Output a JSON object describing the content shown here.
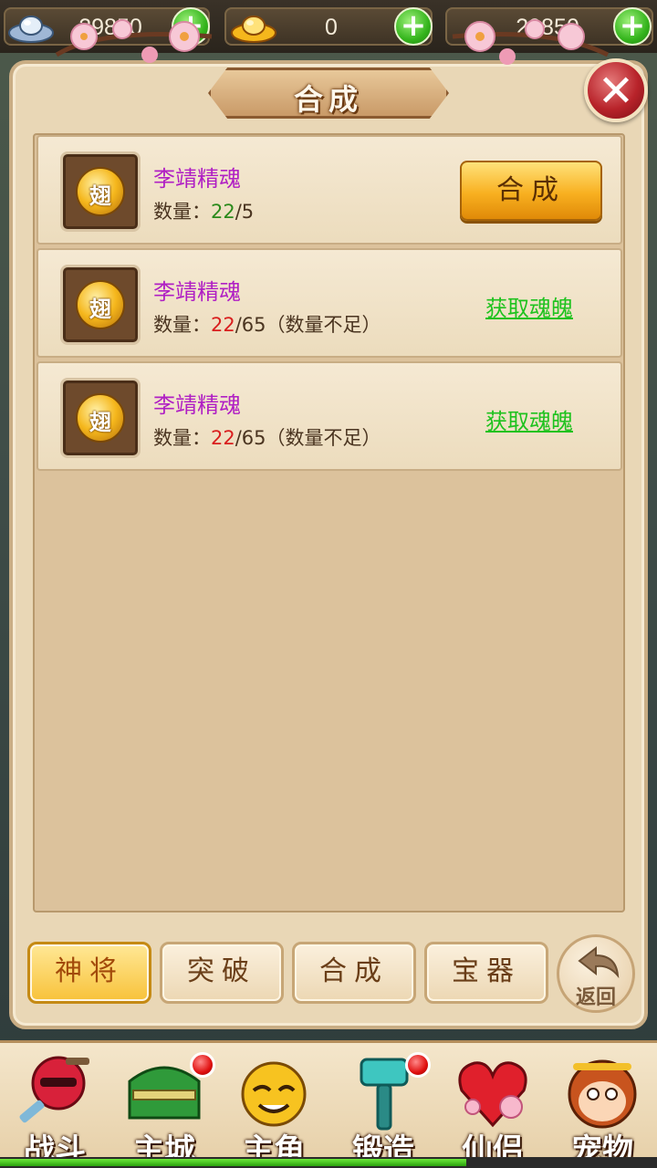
{
  "currency": {
    "silver": "29850",
    "ingot": "0",
    "third": "29850"
  },
  "panel": {
    "title": "合成",
    "close_label": "✕"
  },
  "items": [
    {
      "name": "李靖精魂",
      "qty_label": "数量：",
      "have": "22",
      "need": "/5",
      "note": "",
      "action": "合成",
      "coin_char": "翅"
    },
    {
      "name": "李靖精魂",
      "qty_label": "数量：",
      "have": "22",
      "need": "/65",
      "note": "（数量不足）",
      "action": "获取魂魄",
      "coin_char": "翅"
    },
    {
      "name": "李靖精魂",
      "qty_label": "数量：",
      "have": "22",
      "need": "/65",
      "note": "（数量不足）",
      "action": "获取魂魄",
      "coin_char": "翅"
    }
  ],
  "tabs": [
    {
      "label": "神将",
      "active": true
    },
    {
      "label": "突破",
      "active": false
    },
    {
      "label": "合成",
      "active": false
    },
    {
      "label": "宝器",
      "active": false
    }
  ],
  "back_label": "返回",
  "nav": [
    {
      "label": "战斗",
      "icon": "ninja-icon",
      "badge": false
    },
    {
      "label": "主城",
      "icon": "castle-icon",
      "badge": true
    },
    {
      "label": "主角",
      "icon": "hero-face-icon",
      "badge": false
    },
    {
      "label": "锻造",
      "icon": "hammer-icon",
      "badge": true
    },
    {
      "label": "仙侣",
      "icon": "heart-flower-icon",
      "badge": false
    },
    {
      "label": "宠物",
      "icon": "monkey-icon",
      "badge": false
    }
  ],
  "progress": {
    "value": 0.71
  },
  "colors": {
    "accent_gold": "#f8b020",
    "name_purple": "#b01fc4",
    "ok_green": "#2b8a1c",
    "bad_red": "#d91e1e",
    "link_green": "#1ec21e"
  }
}
